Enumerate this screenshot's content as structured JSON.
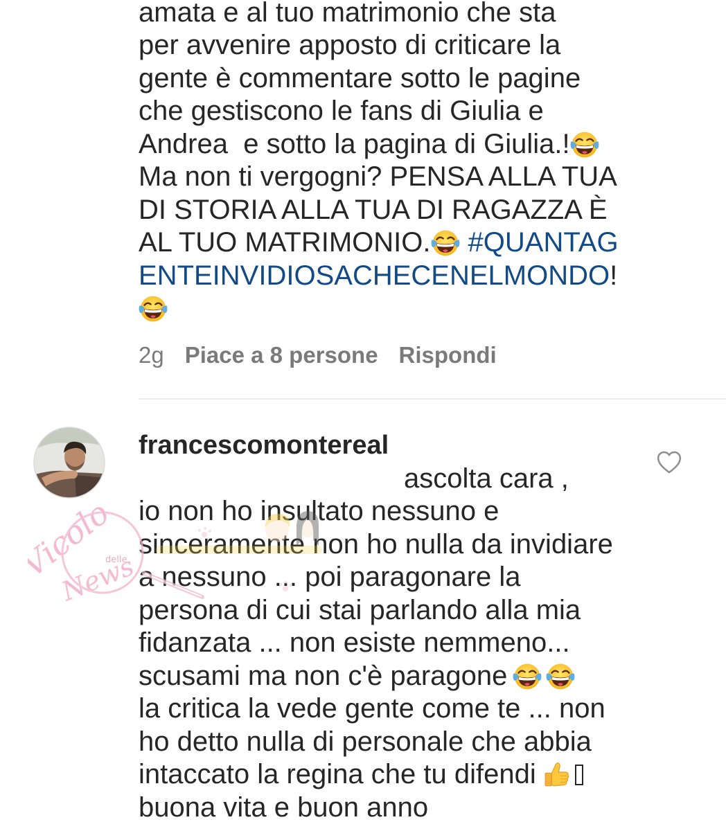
{
  "colors": {
    "text": "#262626",
    "meta": "#7a7a7a",
    "hashtag": "#124a86",
    "divider": "#ebebeb",
    "background": "#ffffff"
  },
  "comment_previous": {
    "lines": [
      "amata e al tuo matrimonio che sta",
      "per avvenire apposto di criticare la",
      "gente è commentare sotto le pagine",
      "che gestiscono le fans di Giulia e",
      "Andrea  e sotto la pagina di Giulia.!",
      "Ma non ti vergogni? PENSA ALLA TUA",
      "DI STORIA ALLA TUA DI RAGAZZA È",
      "AL TUO MATRIMONIO."
    ],
    "hashtag": {
      "part1": "#QUANTAG",
      "part2": "ENTEINVIDIOSACHECENELMONDO"
    },
    "hashtag_trailing": "!",
    "emoji_icon": "face-with-tears-of-joy-icon",
    "time": "2g",
    "likes": "Piace a 8 persone",
    "reply_label": "Rispondi"
  },
  "comment_reply": {
    "username": "francescomontereal",
    "avatar_icon": "profile-photo",
    "like_icon": "heart-outline-icon",
    "lines": [
      "ascolta cara ,",
      "io non ho insultato nessuno e",
      "sinceramente non ho nulla da invidiare",
      "a nessuno ... poi paragonare la",
      "persona di cui stai parlando alla mia",
      "fidanzata ... non esiste nemmeno...",
      "scusami ma non c'è paragone",
      "la critica la vede gente come te ... non",
      "ho detto nulla di personale che abbia",
      "intaccato la regina che tu difendi",
      "buona vita e buon anno"
    ],
    "emoji_icons": [
      "face-with-tears-of-joy-icon",
      "thumbs-up-icon"
    ]
  },
  "watermark": {
    "line1": "Vicolo",
    "line2": "delle",
    "line3": "News"
  }
}
